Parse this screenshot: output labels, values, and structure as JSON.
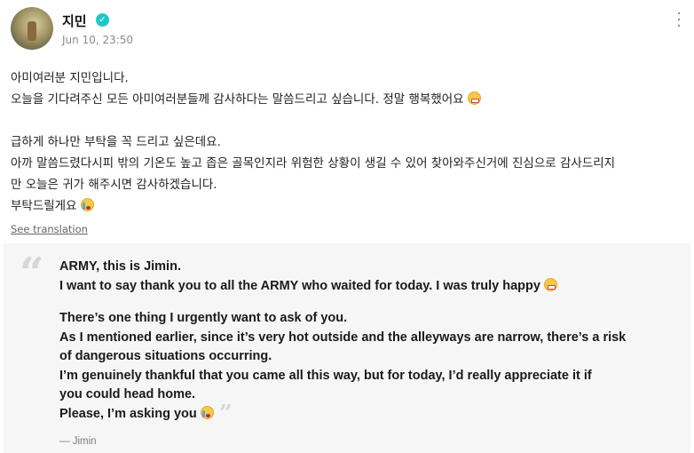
{
  "post": {
    "author": "지민",
    "timestamp": "Jun 10, 23:50",
    "original_lines": [
      "아미여러분 지민입니다.",
      "오늘을 기다려주신 모든 아미여러분들께 감사하다는 말씀드리고 싶습니다. 정말 행복했어요",
      "",
      "급하게 하나만 부탁을 꼭 드리고 싶은데요.",
      "아까 말씀드렸다시피 밖의 기온도 높고 좁은 골목인지라 위험한 상황이 생길 수 있어 찾아와주신거에 진심으로 감사드리지",
      "만 오늘은 귀가 해주시면 감사하겠습니다.",
      "부탁드릴게요"
    ],
    "see_translation": "See translation"
  },
  "translation": {
    "lines": [
      "ARMY, this is Jimin.",
      "I want to say thank you to all the ARMY who waited for today. I was truly happy",
      "",
      "There’s one thing I urgently want to ask of you.",
      "As I mentioned earlier, since it’s very hot outside and the alleyways are narrow, there’s a risk",
      "of dangerous situations occurring.",
      "I’m genuinely thankful that you came all this way, but for today, I’d really appreciate it if",
      "you could head home.",
      "Please, I’m asking you"
    ],
    "signature": "— Jimin"
  },
  "icons": {
    "verified": "verified-badge-icon",
    "more": "more-vertical-icon",
    "emoji_grin": "grinning-emoji-icon",
    "emoji_tears": "crying-emoji-icon"
  },
  "colors": {
    "verified": "#1ec8c8",
    "translation_bg": "#f6f6f6",
    "meta_text": "#8a8a8a"
  }
}
